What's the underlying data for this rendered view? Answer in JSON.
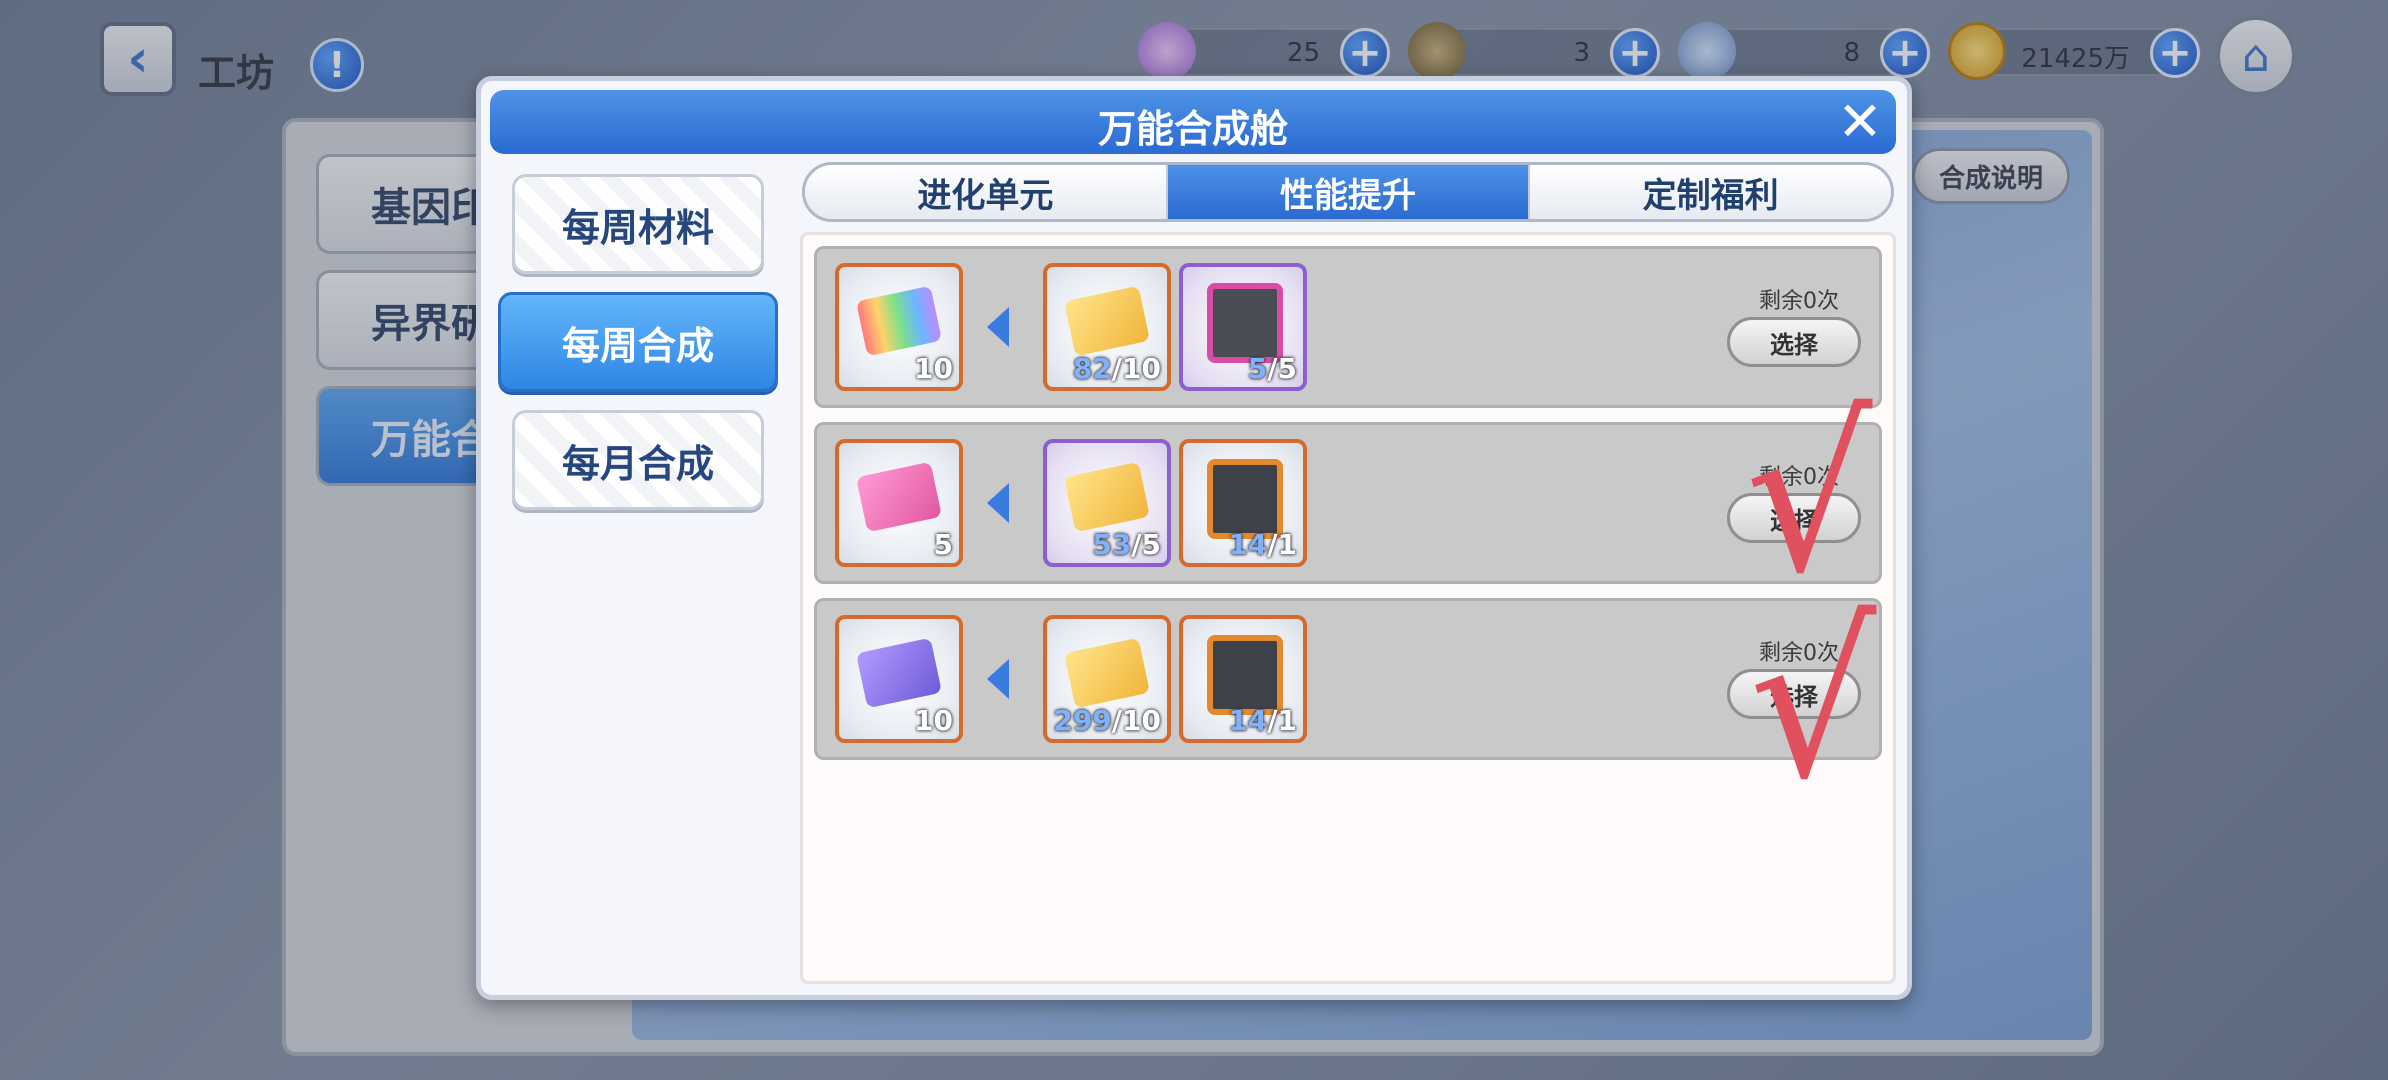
{
  "topbar": {
    "back_icon": "‹",
    "title": "工坊",
    "info_icon": "!",
    "resources": [
      {
        "icon": "potion-icon",
        "value": "25"
      },
      {
        "icon": "treasure-chest-icon",
        "value": "3"
      },
      {
        "icon": "compass-icon",
        "value": "8"
      },
      {
        "icon": "gold-coin-icon",
        "value": "21425万"
      }
    ],
    "plus_label": "+",
    "home_icon": "⌂"
  },
  "background": {
    "left_buttons": [
      "基因印",
      "异界研",
      "万能合"
    ],
    "help_label": "合成说明"
  },
  "modal": {
    "title": "万能合成舱",
    "close_label": "✕",
    "sidebar": [
      "每周材料",
      "每周合成",
      "每月合成"
    ],
    "active_sidebar_index": 1,
    "tabs": [
      "进化单元",
      "性能提升",
      "定制福利"
    ],
    "active_tab_index": 1,
    "recipes": [
      {
        "output": {
          "count": "10",
          "art": "rainbow-ticket"
        },
        "inputs": [
          {
            "have": "82",
            "need": "/10",
            "art": "gold-shard",
            "frame": "orange"
          },
          {
            "have": "5",
            "need": "/5",
            "art": "pink-chip",
            "frame": "purple"
          }
        ],
        "remain": "剩余0次",
        "button": "选择"
      },
      {
        "output": {
          "count": "5",
          "art": "pink-dna-card"
        },
        "inputs": [
          {
            "have": "53",
            "need": "/5",
            "art": "gold-dna-card",
            "frame": "purple"
          },
          {
            "have": "14",
            "need": "/1",
            "art": "orange-chip",
            "frame": "orange"
          }
        ],
        "remain": "剩余0次",
        "button": "选择"
      },
      {
        "output": {
          "count": "10",
          "art": "purple-sword-card"
        },
        "inputs": [
          {
            "have": "299",
            "need": "/10",
            "art": "gold-sword-card",
            "frame": "orange"
          },
          {
            "have": "14",
            "need": "/1",
            "art": "orange-chip",
            "frame": "orange"
          }
        ],
        "remain": "剩余0次",
        "button": "选择"
      }
    ]
  },
  "annotations": {
    "check_mark": "√"
  },
  "colors": {
    "accent_blue": "#2a6ad1",
    "check_red": "#e1505e",
    "frame_orange": "#d46a2c",
    "frame_purple": "#8c5fd0"
  }
}
